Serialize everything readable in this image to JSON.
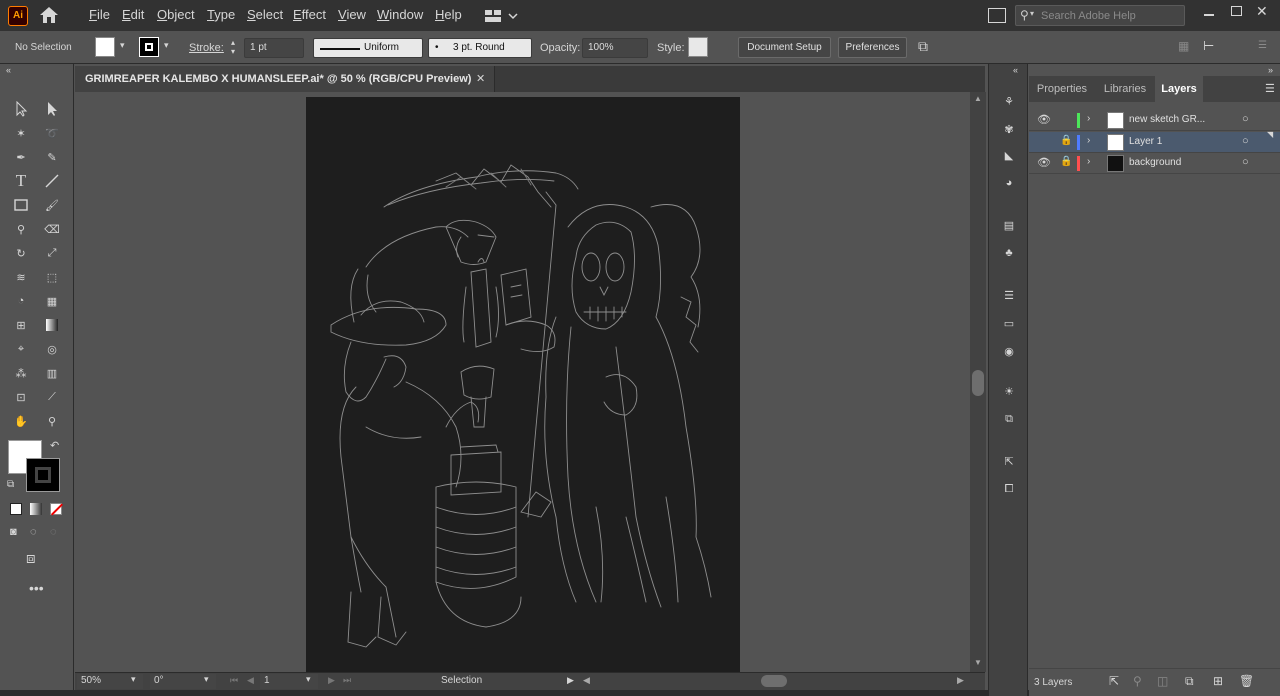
{
  "app": {
    "logo": "Ai"
  },
  "menu": [
    "File",
    "Edit",
    "Object",
    "Type",
    "Select",
    "Effect",
    "View",
    "Window",
    "Help"
  ],
  "search": {
    "placeholder": "Search Adobe Help"
  },
  "control": {
    "selection": "No Selection",
    "stroke_label": "Stroke:",
    "stroke_weight": "1 pt",
    "profile": "Uniform",
    "brush": "3 pt. Round",
    "opacity_label": "Opacity:",
    "opacity": "100%",
    "style_label": "Style:",
    "doc_setup": "Document Setup",
    "preferences": "Preferences"
  },
  "document": {
    "tab_title": "GRIMREAPER KALEMBO X HUMANSLEEP.ai* @ 50 % (RGB/CPU Preview)",
    "close": "✕"
  },
  "status": {
    "zoom": "50%",
    "rotation": "0°",
    "artboard": "1",
    "tool": "Selection"
  },
  "panels": {
    "tabs": [
      "Properties",
      "Libraries",
      "Layers"
    ],
    "active": "Layers"
  },
  "layers": [
    {
      "name": "new sketch GR...",
      "color": "#4ce65a",
      "visible": true,
      "locked": false,
      "selected": false
    },
    {
      "name": "Layer 1",
      "color": "#4f7cff",
      "visible": false,
      "locked": true,
      "selected": true
    },
    {
      "name": "background",
      "color": "#ff4f4f",
      "visible": true,
      "locked": true,
      "selected": false
    }
  ],
  "layers_footer": {
    "count": "3 Layers"
  },
  "colors": {
    "chrome_dark": "#323232",
    "panel": "#535353",
    "artboard": "#1e1e1e",
    "selection": "#4b5a6e"
  }
}
